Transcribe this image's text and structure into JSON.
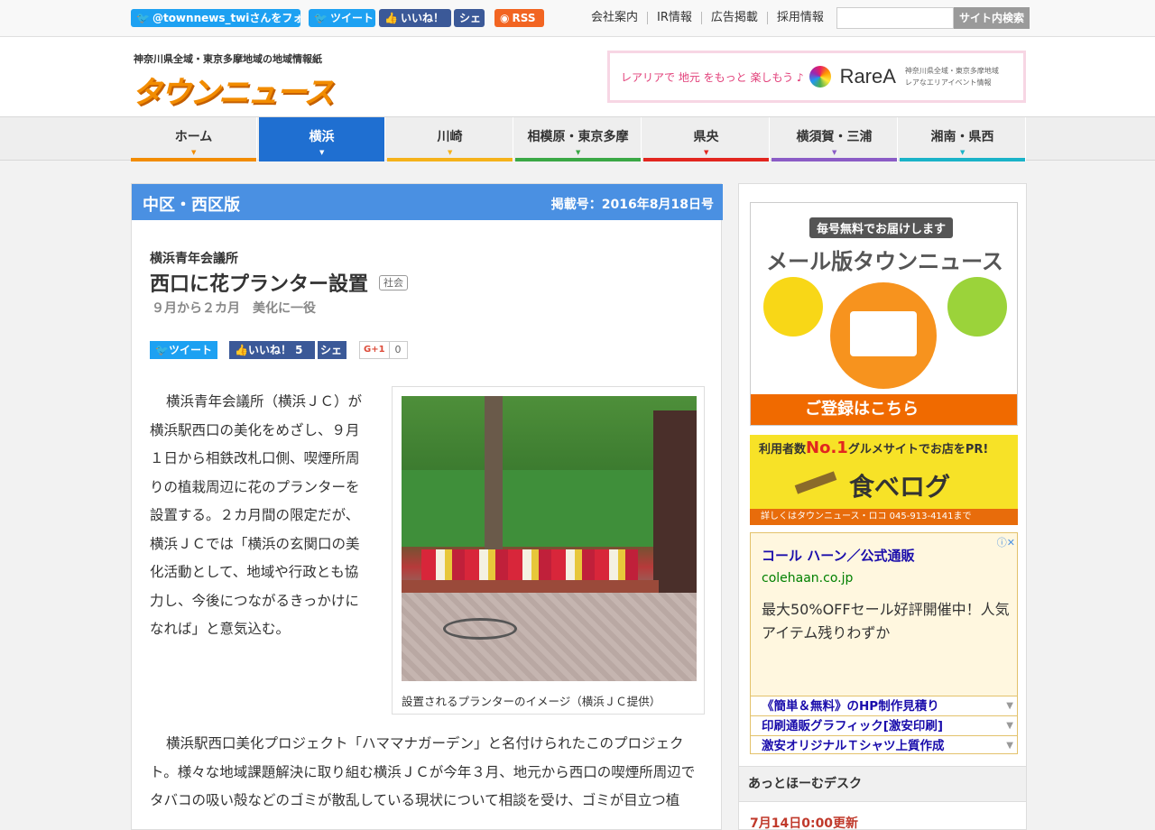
{
  "topbar": {
    "twitter_follow": "@townnews_twiさんをフォ",
    "tweet": "ツイート",
    "like": "いいね！",
    "share": "シェ",
    "rss": "RSS",
    "links": [
      "会社案内",
      "IR情報",
      "広告掲載",
      "採用情報"
    ],
    "search_placeholder": "",
    "search_button": "サイト内検索"
  },
  "header": {
    "tagline": "神奈川県全域・東京多摩地域の地域情報紙",
    "logo": "タウンニュース",
    "banner": {
      "catch": "レアリアで 地元 をもっと 楽しもう ♪",
      "brand": "RareA",
      "sub1": "神奈川県全域・東京多摩地域",
      "sub2": "レアなエリアイベント情報"
    }
  },
  "nav": {
    "items": [
      {
        "label": "ホーム",
        "color": "#f28c00"
      },
      {
        "label": "横浜",
        "color": "#1f6fd1"
      },
      {
        "label": "川崎",
        "color": "#f5b21a"
      },
      {
        "label": "相模原・東京多摩",
        "color": "#3aa845"
      },
      {
        "label": "県央",
        "color": "#e2261f"
      },
      {
        "label": "横須賀・三浦",
        "color": "#8b5cc6"
      },
      {
        "label": "湘南・県西",
        "color": "#1ab3c8"
      }
    ],
    "active_index": 1
  },
  "article": {
    "edition": "中区・西区版",
    "issue": "掲載号：2016年8月18日号",
    "org": "横浜青年会議所",
    "title": "西口に花プランター設置",
    "tag": "社会",
    "subtitle": "９月から２カ月　美化に一役",
    "share": {
      "tweet": "ツイート",
      "like": "いいね！ 5",
      "share": "シェ",
      "gplus": "G+1",
      "gplus_count": "0"
    },
    "paragraph1": "横浜青年会議所（横浜ＪＣ）が横浜駅西口の美化をめざし、９月１日から相鉄改札口側、喫煙所周りの植栽周辺に花のプランターを設置する。２カ月間の限定だが、横浜ＪＣでは「横浜の玄関口の美化活動として、地域や行政とも協力し、今後につながるきっかけになれば」と意気込む。",
    "caption": "設置されるプランターのイメージ（横浜ＪＣ提供）",
    "paragraph2": "横浜駅西口美化プロジェクト「ハママナガーデン」と名付けられたこのプロジェクト。様々な地域課題解決に取り組む横浜ＪＣが今年３月、地元から西口の喫煙所周辺でタバコの吸い殻などのゴミが散乱している現状について相談を受け、ゴミが目立つ植"
  },
  "sidebar": {
    "mail_ad": {
      "pill": "毎号無料でお届けします",
      "heading": "メール版タウンニュース",
      "cta": "ご登録はこちら"
    },
    "tabelog": {
      "line1_pre": "利用者数",
      "line1_em": "No.1",
      "line1_post": "グルメサイトでお店をPR!",
      "name": "食べログ",
      "footer": "詳しくはタウンニュース・ロコ 045-913-4141まで"
    },
    "ad": {
      "title": "コール ハーン／公式通販",
      "url": "colehaan.co.jp",
      "text": "最大50%OFFセール好評開催中！人気アイテム残りわずか",
      "links": [
        "《簡単＆無料》のHP制作見積り",
        "印刷通販グラフィック[激安印刷]",
        "激安オリジナルＴシャツ上質作成"
      ]
    },
    "desk_heading": "あっとほーむデスク",
    "updated": "7月14日0:00更新"
  }
}
